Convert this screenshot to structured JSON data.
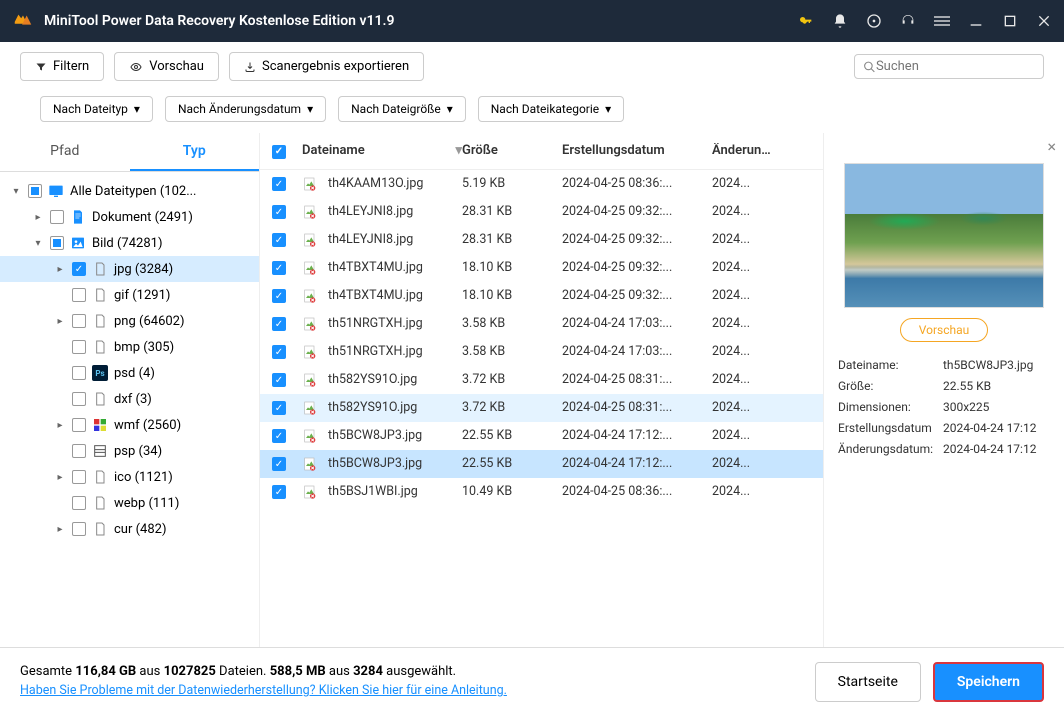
{
  "title": "MiniTool Power Data Recovery Kostenlose Edition v11.9",
  "toolbar": {
    "filter": "Filtern",
    "preview": "Vorschau",
    "export": "Scanergebnis exportieren",
    "search_ph": "Suchen"
  },
  "filters": {
    "type": "Nach Dateityp",
    "date": "Nach Änderungsdatum",
    "size": "Nach Dateigröße",
    "cat": "Nach Dateikategorie"
  },
  "tabs": {
    "path": "Pfad",
    "type": "Typ"
  },
  "tree": [
    {
      "ind": 0,
      "exp": "down",
      "chk": "ind",
      "icon": "monitor",
      "lbl": "Alle Dateitypen (102...",
      "sel": false
    },
    {
      "ind": 1,
      "exp": "right",
      "chk": "off",
      "icon": "doc",
      "lbl": "Dokument (2491)",
      "sel": false
    },
    {
      "ind": 1,
      "exp": "down",
      "chk": "ind",
      "icon": "img",
      "lbl": "Bild (74281)",
      "sel": false
    },
    {
      "ind": 2,
      "exp": "right",
      "chk": "chk",
      "icon": "file",
      "lbl": "jpg (3284)",
      "sel": true
    },
    {
      "ind": 2,
      "exp": "",
      "chk": "off",
      "icon": "file",
      "lbl": "gif (1291)",
      "sel": false
    },
    {
      "ind": 2,
      "exp": "right",
      "chk": "off",
      "icon": "file",
      "lbl": "png (64602)",
      "sel": false
    },
    {
      "ind": 2,
      "exp": "",
      "chk": "off",
      "icon": "file",
      "lbl": "bmp (305)",
      "sel": false
    },
    {
      "ind": 2,
      "exp": "",
      "chk": "off",
      "icon": "psd",
      "lbl": "psd (4)",
      "sel": false
    },
    {
      "ind": 2,
      "exp": "",
      "chk": "off",
      "icon": "file",
      "lbl": "dxf (3)",
      "sel": false
    },
    {
      "ind": 2,
      "exp": "right",
      "chk": "off",
      "icon": "wmf",
      "lbl": "wmf (2560)",
      "sel": false
    },
    {
      "ind": 2,
      "exp": "",
      "chk": "off",
      "icon": "psp",
      "lbl": "psp (34)",
      "sel": false
    },
    {
      "ind": 2,
      "exp": "right",
      "chk": "off",
      "icon": "file",
      "lbl": "ico (1121)",
      "sel": false
    },
    {
      "ind": 2,
      "exp": "",
      "chk": "off",
      "icon": "file",
      "lbl": "webp (111)",
      "sel": false
    },
    {
      "ind": 2,
      "exp": "right",
      "chk": "off",
      "icon": "file",
      "lbl": "cur (482)",
      "sel": false
    }
  ],
  "cols": {
    "name": "Dateiname",
    "size": "Größe",
    "created": "Erstellungsdatum",
    "modified": "Änderungs"
  },
  "rows": [
    {
      "name": "th4KAAM13O.jpg",
      "size": "5.19 KB",
      "created": "2024-04-25 08:36:...",
      "mod": "2024...",
      "st": ""
    },
    {
      "name": "th4LEYJNI8.jpg",
      "size": "28.31 KB",
      "created": "2024-04-25 09:32:...",
      "mod": "2024...",
      "st": ""
    },
    {
      "name": "th4LEYJNI8.jpg",
      "size": "28.31 KB",
      "created": "2024-04-25 09:32:...",
      "mod": "2024...",
      "st": ""
    },
    {
      "name": "th4TBXT4MU.jpg",
      "size": "18.10 KB",
      "created": "2024-04-25 09:32:...",
      "mod": "2024...",
      "st": ""
    },
    {
      "name": "th4TBXT4MU.jpg",
      "size": "18.10 KB",
      "created": "2024-04-25 09:32:...",
      "mod": "2024...",
      "st": ""
    },
    {
      "name": "th51NRGTXH.jpg",
      "size": "3.58 KB",
      "created": "2024-04-24 17:03:...",
      "mod": "2024...",
      "st": ""
    },
    {
      "name": "th51NRGTXH.jpg",
      "size": "3.58 KB",
      "created": "2024-04-24 17:03:...",
      "mod": "2024...",
      "st": ""
    },
    {
      "name": "th582YS91O.jpg",
      "size": "3.72 KB",
      "created": "2024-04-25 08:31:...",
      "mod": "2024...",
      "st": ""
    },
    {
      "name": "th582YS91O.jpg",
      "size": "3.72 KB",
      "created": "2024-04-25 08:31:...",
      "mod": "2024...",
      "st": "hl"
    },
    {
      "name": "th5BCW8JP3.jpg",
      "size": "22.55 KB",
      "created": "2024-04-24 17:12:...",
      "mod": "2024...",
      "st": ""
    },
    {
      "name": "th5BCW8JP3.jpg",
      "size": "22.55 KB",
      "created": "2024-04-24 17:12:...",
      "mod": "2024...",
      "st": "sel"
    },
    {
      "name": "th5BSJ1WBI.jpg",
      "size": "10.49 KB",
      "created": "2024-04-25 08:36:...",
      "mod": "2024...",
      "st": ""
    }
  ],
  "preview": {
    "btn": "Vorschau",
    "meta": {
      "k_name": "Dateiname:",
      "v_name": "th5BCW8JP3.jpg",
      "k_size": "Größe:",
      "v_size": "22.55 KB",
      "k_dim": "Dimensionen:",
      "v_dim": "300x225",
      "k_created": "Erstellungsdatum",
      "v_created": "2024-04-24 17:12",
      "k_modified": "Änderungsdatum:",
      "v_modified": "2024-04-24 17:12"
    }
  },
  "footer": {
    "l1a": "Gesamte ",
    "l1b": "116,84 GB",
    "l1c": " aus ",
    "l1d": "1027825",
    "l1e": " Dateien.  ",
    "l1f": "588,5 MB",
    "l1g": " aus ",
    "l1h": "3284",
    "l1i": " ausgewählt.",
    "help": "Haben Sie Probleme mit der Datenwiederherstellung? Klicken Sie hier für eine Anleitung.",
    "home": "Startseite",
    "save": "Speichern"
  }
}
